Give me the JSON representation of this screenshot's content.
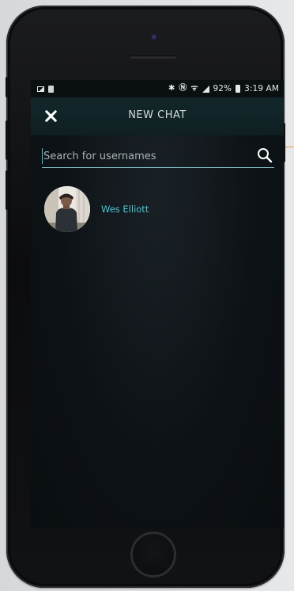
{
  "status_bar": {
    "battery": "92%",
    "time": "3:19 AM",
    "icons": [
      "image-icon",
      "document-icon",
      "bluetooth-icon",
      "nfc-icon",
      "wifi-icon",
      "signal-icon",
      "battery-icon"
    ]
  },
  "header": {
    "title": "NEW CHAT",
    "close_icon": "close-icon"
  },
  "search": {
    "placeholder": "Search for usernames",
    "value": "",
    "icon": "search-icon"
  },
  "results": [
    {
      "name": "Wes Elliott",
      "avatar": "avatar-photo"
    }
  ],
  "colors": {
    "accent": "#45c9d6",
    "header_bg": "#12272a",
    "screen_bg": "#0d1216",
    "annotation": "#f2a43b"
  }
}
